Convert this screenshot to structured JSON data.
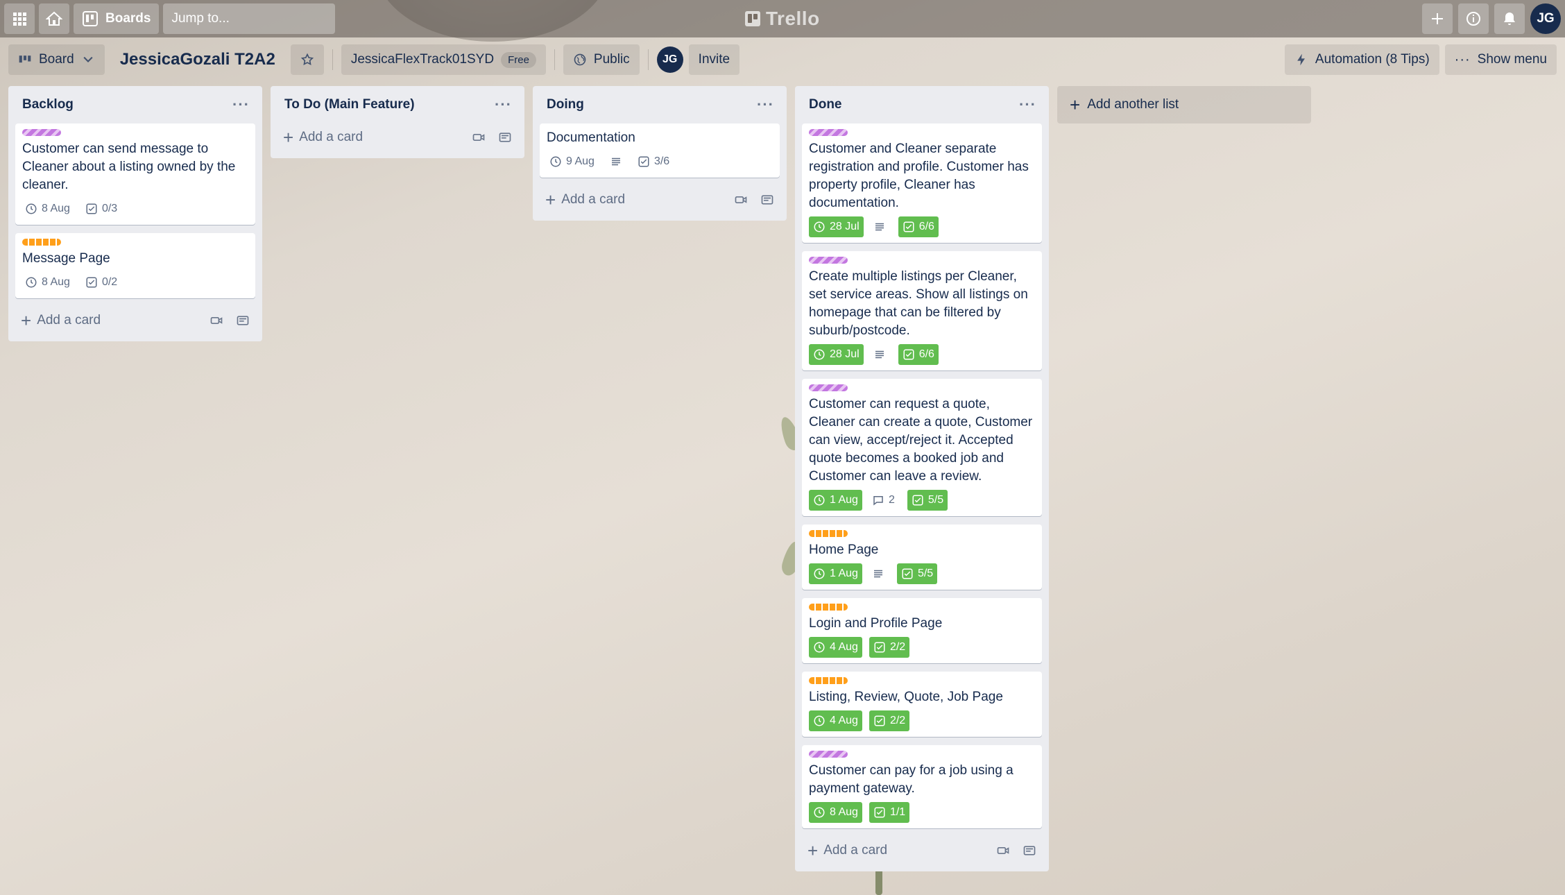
{
  "topbar": {
    "boards_label": "Boards",
    "search_placeholder": "Jump to...",
    "logo_text": "Trello",
    "user_initials": "JG"
  },
  "board": {
    "view_label": "Board",
    "title": "JessicaGozali T2A2",
    "workspace": "JessicaFlexTrack01SYD",
    "workspace_plan": "Free",
    "visibility": "Public",
    "member_initials": "JG",
    "invite_label": "Invite",
    "automation_label": "Automation (8 Tips)",
    "menu_label": "Show menu"
  },
  "colors": {
    "label_purple": "#c377e0",
    "label_orange": "#ff9f1a",
    "badge_green": "#61bd4f"
  },
  "lists": [
    {
      "title": "Backlog",
      "add_label": "Add a card",
      "cards": [
        {
          "label": "purple",
          "title": "Customer can send message to Cleaner about a listing owned by the cleaner.",
          "due": "8 Aug",
          "checklist": "0/3"
        },
        {
          "label": "orange",
          "title": "Message Page",
          "due": "8 Aug",
          "checklist": "0/2"
        }
      ]
    },
    {
      "title": "To Do (Main Feature)",
      "add_label": "Add a card",
      "cards": []
    },
    {
      "title": "Doing",
      "add_label": "Add a card",
      "cards": [
        {
          "label": "",
          "title": "Documentation",
          "due": "9 Aug",
          "has_description": true,
          "checklist": "3/6"
        }
      ]
    },
    {
      "title": "Done",
      "add_label": "Add a card",
      "cards": [
        {
          "label": "purple",
          "title": "Customer and Cleaner separate registration and profile. Customer has property profile, Cleaner has documentation.",
          "due": "28 Jul",
          "has_description": true,
          "checklist": "6/6"
        },
        {
          "label": "purple",
          "title": "Create multiple listings per Cleaner, set service areas. Show all listings on homepage that can be filtered by suburb/postcode.",
          "due": "28 Jul",
          "has_description": true,
          "checklist": "6/6"
        },
        {
          "label": "purple",
          "title": "Customer can request a quote, Cleaner can create a quote, Customer can view, accept/reject it. Accepted quote becomes a booked job and Customer can leave a review.",
          "due": "1 Aug",
          "comments": "2",
          "checklist": "5/5"
        },
        {
          "label": "orange",
          "title": "Home Page",
          "due": "1 Aug",
          "has_description": true,
          "checklist": "5/5"
        },
        {
          "label": "orange",
          "title": "Login and Profile Page",
          "due": "4 Aug",
          "checklist": "2/2"
        },
        {
          "label": "orange",
          "title": "Listing, Review, Quote, Job Page",
          "due": "4 Aug",
          "checklist": "2/2"
        },
        {
          "label": "purple",
          "title": "Customer can pay for a job using a payment gateway.",
          "due": "8 Aug",
          "checklist": "1/1"
        }
      ]
    }
  ],
  "add_list_label": "Add another list"
}
